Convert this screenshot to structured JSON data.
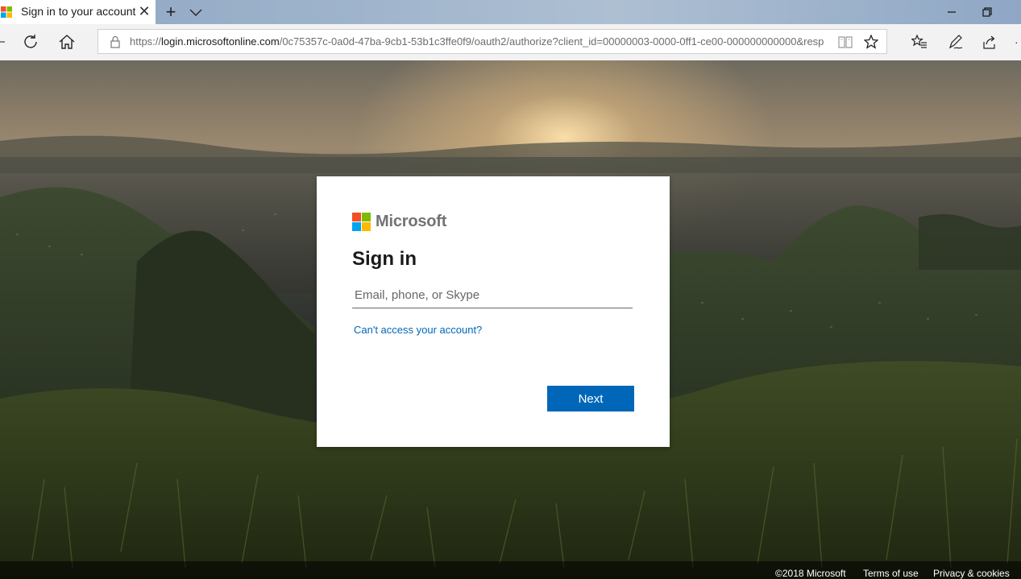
{
  "browser": {
    "tab_title": "Sign in to your account",
    "url_prefix": "https://",
    "url_host": "login.microsoftonline.com",
    "url_path": "/0c75357c-0a0d-47ba-9cb1-53b1c3ffe0f9/oauth2/authorize?client_id=00000003-0000-0ff1-ce00-000000000000&resp",
    "icons": [
      "back-icon",
      "refresh-icon",
      "home-icon",
      "lock-icon",
      "reading-view-icon",
      "favorite-star-icon",
      "favorites-hub-icon",
      "pen-icon",
      "share-icon"
    ]
  },
  "signin": {
    "brand": "Microsoft",
    "heading": "Sign in",
    "email_placeholder": "Email, phone, or Skype",
    "email_value": "",
    "cant_access": "Can't access your account?",
    "next_label": "Next"
  },
  "footer": {
    "copyright": "©2018 Microsoft",
    "terms": "Terms of use",
    "privacy": "Privacy & cookies"
  },
  "colors": {
    "accent": "#0067b8",
    "logo_red": "#f25022",
    "logo_green": "#7fba00",
    "logo_blue": "#00a4ef",
    "logo_yellow": "#ffb900"
  }
}
